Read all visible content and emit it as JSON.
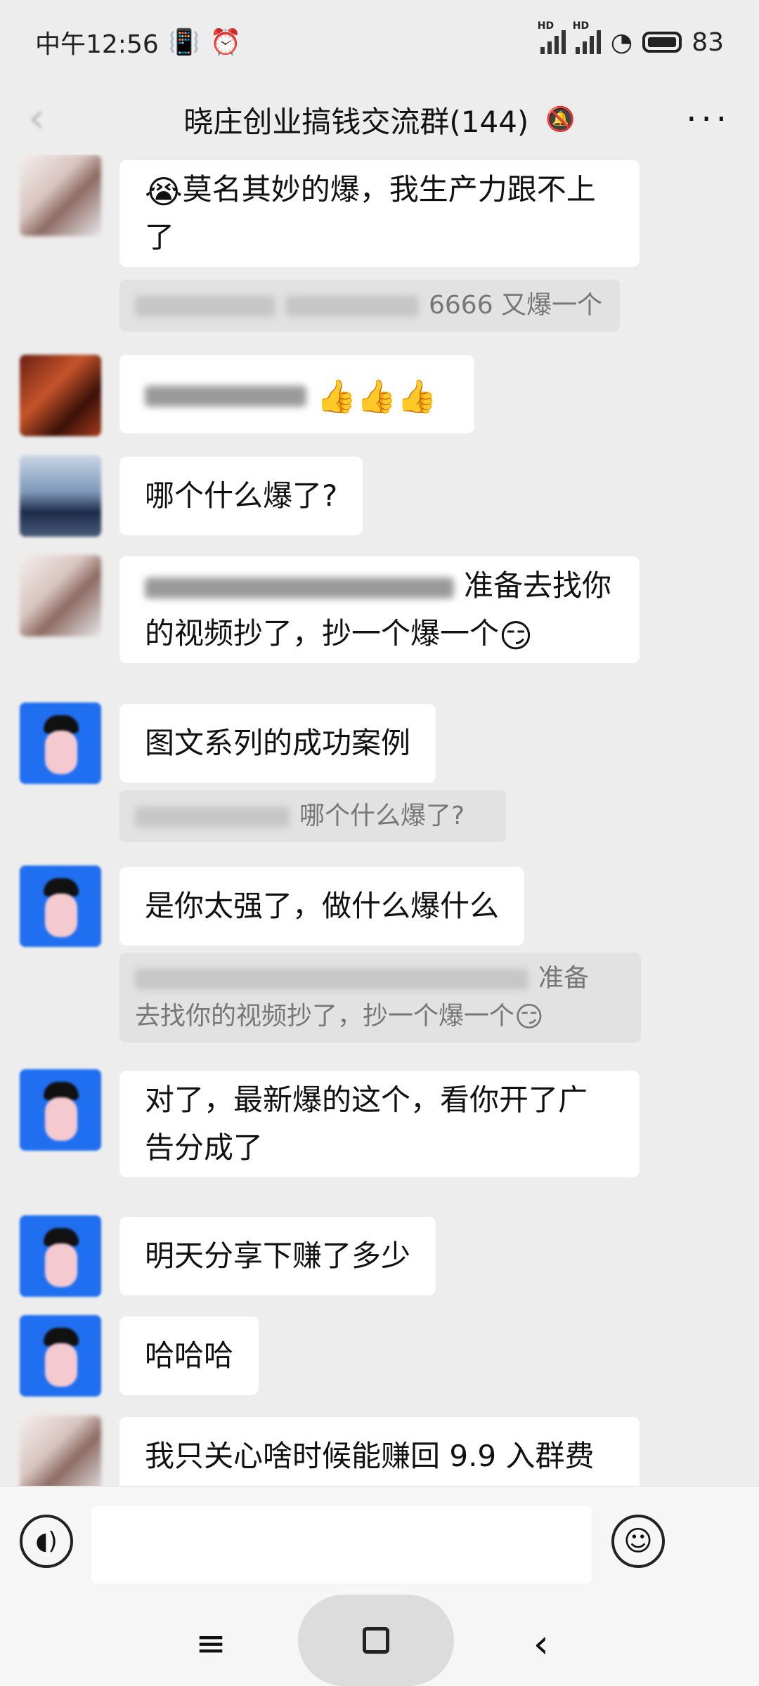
{
  "status_bar": {
    "time": "中午12:56",
    "vibrate_icon": "vibrate-icon",
    "alarm_icon": "alarm-icon",
    "signal_label": "HD",
    "battery": "83"
  },
  "header": {
    "title": "晓庄创业搞钱交流群(144)",
    "mute_icon": "bell-off-icon",
    "more_icon": "more-icon"
  },
  "messages": [
    {
      "text": "莫名其妙的爆，我生产力跟不上了",
      "emoji": "😭"
    },
    {
      "quote_tail": "6666 又爆一个"
    },
    {
      "emoji": "👍👍👍"
    },
    {
      "text": "哪个什么爆了?"
    },
    {
      "text_line1": "准备去找你",
      "text_line2": "的视频抄了，抄一个爆一个",
      "emoji": "😏"
    },
    {
      "text": "图文系列的成功案例"
    },
    {
      "quote_tail": "哪个什么爆了?"
    },
    {
      "text": "是你太强了，做什么爆什么"
    },
    {
      "quote_line1": "准备",
      "quote_line2": "去找你的视频抄了，抄一个爆一个",
      "emoji": "😏"
    },
    {
      "text": "对了，最新爆的这个，看你开了广告分成了"
    },
    {
      "text": "明天分享下赚了多少"
    },
    {
      "text": "哈哈哈"
    },
    {
      "text": "我只关心啥时候能赚回 9.9 入群费"
    }
  ],
  "input_bar": {
    "placeholder": ""
  }
}
